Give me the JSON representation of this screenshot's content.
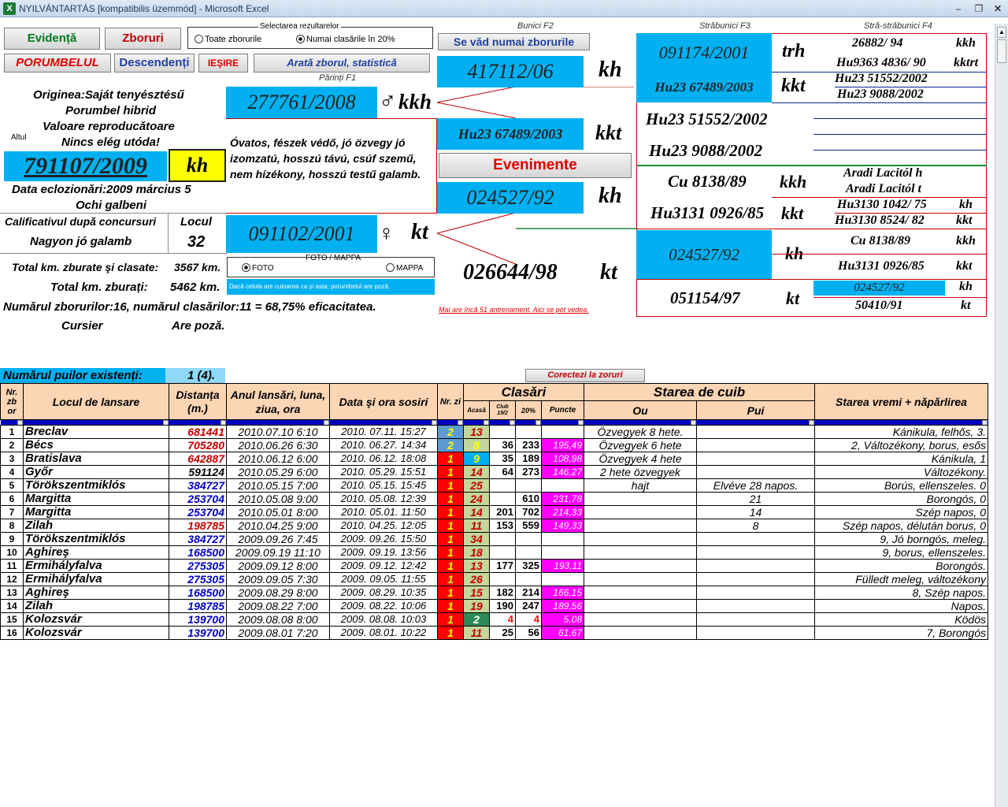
{
  "window": {
    "title": "NYILVÁNTARTÁS  [kompatibilis üzemmód] - Microsoft Excel",
    "minimize": "–",
    "restore": "❐",
    "close": "✕"
  },
  "buttons": {
    "evidenta": "Evidențǎ",
    "zboruri": "Zboruri",
    "porumbelul": "PORUMBELUL",
    "descendenti": "Descendenți",
    "iesire": "IEŞIRE",
    "arata": "Aratǎ zborul, statisticǎ",
    "se_vad": "Se vǎd numai zborurile",
    "evenimente": "Evenimente",
    "corectezi": "Corectezi la zoruri"
  },
  "selection": {
    "title": "Selectarea rezultarelor",
    "opt_all": "Toate zborurile",
    "opt_20": "Numai clasǎrile în 20%",
    "selected": "opt_20"
  },
  "headings": {
    "bunici": "Bunici F2",
    "strabunici": "Strǎbunici F3",
    "stra_strabunici": "Strǎ-strǎbunici F4",
    "parinti": "Pǎrinți F1"
  },
  "bird": {
    "origin": "Originea:Saját tenyésztésű",
    "type": "Porumbel hibrid",
    "value": "Valoare reproducǎtoare",
    "offspring": "Nincs elég utóda!",
    "altul": "Altul",
    "ring": "791107/2009",
    "code": "kh",
    "hatch": "Data eclozionǎri:2009  március   5",
    "eyes": "Ochi galbeni",
    "calif_label": "Calificativul dupǎ concursuri",
    "calif_value": "Nagyon jó galamb",
    "locul_label": "Locul",
    "locul_value": "32",
    "km_clasate_label": "Total km. zburate şi clasate:",
    "km_clasate_value": "3567 km.",
    "km_zburati_label": "Total km. zburați:",
    "km_zburati_value": "5462 km.",
    "summary": "Numǎrul zborurilor:16,  numǎrul clasǎrilor:11 = 68,75% eficacitatea.",
    "cursier": "Cursier",
    "poza": "Are pozǎ.",
    "puilor_label": "Numǎrul puilor existenți:",
    "puilor_value": "1 (4)."
  },
  "parents": {
    "father_ring": "277761/2008",
    "father_sym": "♂",
    "father_code": "kkh",
    "note": "Óvatos, fészek védő, jó özvegy jó izomzatú, hosszú távú, csúf szemű, nem hízékony, hosszú testű galamb.",
    "mother_ring": "091102/2001",
    "mother_sym": "♀",
    "mother_code": "kt",
    "foto_label": "FOTO   /     MAPPA",
    "foto_opt": "FOTO",
    "mappa_opt": "MAPPA",
    "color_note": "Dacǎ celula are culoarea ca şi asta: porumbelul are pozǎ."
  },
  "grandparents": {
    "g1_ring": "417112/06",
    "g1_code": "kh",
    "g2_ring": "Hu23 67489/2003",
    "g2_code": "kkt",
    "g3_ring": "024527/92",
    "g3_code": "kh",
    "g4_ring": "026644/98",
    "g4_code": "kt",
    "training_note": "Mai are încǎ 51 antrenament. Aici se pot vedea."
  },
  "great": {
    "r1_ring": "091174/2001",
    "r1_code": "trh",
    "r2_ring": "Hu23 67489/2003",
    "r2_code": "kkt",
    "r3_ring": "Hu23 51552/2002",
    "r4_ring": "Hu23 9088/2002",
    "r5_ring": "Cu 8138/89",
    "r5_code": "kkh",
    "r6_ring": "Hu3131 0926/85",
    "r6_code": "kkt",
    "r7_ring": "024527/92",
    "r7_code": "kh",
    "r8_ring": "051154/97",
    "r8_code": "kt"
  },
  "great2": {
    "a1": "26882/ 94",
    "a1c": "kkh",
    "a2": "Hu9363 4836/ 90",
    "a2c": "kktrt",
    "a3": "Hu23 51552/2002",
    "a4": "Hu23 9088/2002",
    "a5": "Aradi Lacitól h",
    "a6": "Aradi Lacitól t",
    "a7": "Hu3130 1042/ 75",
    "a7c": "kh",
    "a8": "Hu3130 8524/ 82",
    "a8c": "kkt",
    "a9": "Cu 8138/89",
    "a9c": "kkh",
    "a10": "Hu3131 0926/85",
    "a10c": "kkt",
    "a11": "024527/92",
    "a11c": "kh",
    "a12": "50410/91",
    "a12c": "kt"
  },
  "table": {
    "headers": {
      "nr": "Nr. zb or",
      "loc": "Locul de lansare",
      "dist": "Distanța (m.)",
      "an": "Anul lansǎri, luna, ziua, ora",
      "data": "Data şi ora sosiri",
      "nrzi": "Nr. zi",
      "clasari": "Clasǎri",
      "acasa": "Acasǎ",
      "club": "Club 19/2",
      "p20": "20%",
      "puncte": "Puncte",
      "cuib": "Starea de cuib",
      "ou": "Ou",
      "pui": "Pui",
      "vreme": "Starea vremi + nǎpǎrlirea"
    },
    "rows": [
      {
        "nr": "1",
        "loc": "Breclav",
        "dist": "681441",
        "dc": "#c00000",
        "an": "2010.07.10 6:10",
        "data": "2010. 07.11. 15:27",
        "nz": "2",
        "nzbg": "#5b9bd5",
        "nzc": "#ffff00",
        "ac": "13",
        "acc": "#c00000",
        "club": "",
        "p20": "",
        "pct": "",
        "ou": "Özvegyek 8 hete.",
        "pui": "",
        "st": "Kánikula, felhős, 3."
      },
      {
        "nr": "2",
        "loc": "Bécs",
        "dist": "705280",
        "dc": "#c00000",
        "an": "2010.06.26 6:30",
        "data": "2010. 06.27. 14:34",
        "nz": "2",
        "nzbg": "#5b9bd5",
        "nzc": "#ffff00",
        "ac": "8",
        "acc": "#ffff00",
        "club": "36",
        "p20": "233",
        "pct": "195,49",
        "ou": "Özvegyek 6 hete",
        "pui": "",
        "st": "2, Változékony, borus, esős"
      },
      {
        "nr": "3",
        "loc": "Bratislava",
        "dist": "642887",
        "dc": "#c00000",
        "an": "2010.06.12 6:00",
        "data": "2010. 06.12. 18:08",
        "nz": "1",
        "nzbg": "#ff0000",
        "nzc": "#ffff00",
        "ac": "9",
        "acc": "#ffff00",
        "acbg": "#00b0f0",
        "club": "35",
        "p20": "189",
        "pct": "108,98",
        "ou": "Özvegyek 4 hete",
        "pui": "",
        "st": "Kánikula, 1"
      },
      {
        "nr": "4",
        "loc": "Győr",
        "dist": "591124",
        "dc": "#000000",
        "an": "2010.05.29 6:00",
        "data": "2010. 05.29. 15:51",
        "nz": "1",
        "nzbg": "#ff0000",
        "nzc": "#ffff00",
        "ac": "14",
        "acc": "#c00000",
        "club": "64",
        "p20": "273",
        "pct": "146,27",
        "ou": "2 hete özvegyek",
        "pui": "",
        "st": "Változékony."
      },
      {
        "nr": "5",
        "loc": "Törökszentmiklós",
        "dist": "384727",
        "dc": "#0000c0",
        "an": "2010.05.15 7:00",
        "data": "2010. 05.15. 15:45",
        "nz": "1",
        "nzbg": "#ff0000",
        "nzc": "#ffff00",
        "ac": "25",
        "acc": "#c00000",
        "club": "",
        "p20": "",
        "pct": "",
        "ou": "hajt",
        "pui": "Elvéve 28 napos.",
        "st": "Borús, ellenszeles. 0"
      },
      {
        "nr": "6",
        "loc": "Margitta",
        "dist": "253704",
        "dc": "#0000c0",
        "an": "2010.05.08 9:00",
        "data": "2010. 05.08. 12:39",
        "nz": "1",
        "nzbg": "#ff0000",
        "nzc": "#ffff00",
        "ac": "24",
        "acc": "#c00000",
        "club": "",
        "p20": "610",
        "pct": "231,78",
        "ou": "",
        "pui": "21",
        "st": "Borongós, 0"
      },
      {
        "nr": "7",
        "loc": "Margitta",
        "dist": "253704",
        "dc": "#0000c0",
        "an": "2010.05.01 8:00",
        "data": "2010. 05.01. 11:50",
        "nz": "1",
        "nzbg": "#ff0000",
        "nzc": "#ffff00",
        "ac": "14",
        "acc": "#c00000",
        "club": "201",
        "p20": "702",
        "pct": "214,33",
        "ou": "",
        "pui": "14",
        "st": "Szép napos, 0"
      },
      {
        "nr": "8",
        "loc": "Zilah",
        "dist": "198785",
        "dc": "#c00000",
        "an": "2010.04.25 9:00",
        "data": "2010. 04.25. 12:05",
        "nz": "1",
        "nzbg": "#ff0000",
        "nzc": "#ffff00",
        "ac": "11",
        "acc": "#c00000",
        "club": "153",
        "p20": "559",
        "pct": "149,33",
        "ou": "",
        "pui": "8",
        "st": "Szép napos, délután borus, 0"
      },
      {
        "nr": "9",
        "loc": "Törökszentmiklós",
        "dist": "384727",
        "dc": "#0000c0",
        "an": "2009.09.26 7:45",
        "data": "2009. 09.26. 15:50",
        "nz": "1",
        "nzbg": "#ff0000",
        "nzc": "#ffff00",
        "ac": "34",
        "acc": "#c00000",
        "club": "",
        "p20": "",
        "pct": "",
        "ou": "",
        "pui": "",
        "st": "9, Jó borngós, meleg."
      },
      {
        "nr": "10",
        "loc": "Aghireş",
        "dist": "168500",
        "dc": "#0000c0",
        "an": "2009.09.19 11:10",
        "data": "2009. 09.19. 13:56",
        "nz": "1",
        "nzbg": "#ff0000",
        "nzc": "#ffff00",
        "ac": "18",
        "acc": "#c00000",
        "club": "",
        "p20": "",
        "pct": "",
        "ou": "",
        "pui": "",
        "st": "9, borus, ellenszeles."
      },
      {
        "nr": "11",
        "loc": "Ermihályfalva",
        "dist": "275305",
        "dc": "#0000c0",
        "an": "2009.09.12 8:00",
        "data": "2009. 09.12. 12:42",
        "nz": "1",
        "nzbg": "#ff0000",
        "nzc": "#ffff00",
        "ac": "13",
        "acc": "#c00000",
        "club": "177",
        "p20": "325",
        "pct": "193,11",
        "ou": "",
        "pui": "",
        "st": "Borongós."
      },
      {
        "nr": "12",
        "loc": "Ermihályfalva",
        "dist": "275305",
        "dc": "#0000c0",
        "an": "2009.09.05 7:30",
        "data": "2009. 09.05. 11:55",
        "nz": "1",
        "nzbg": "#ff0000",
        "nzc": "#ffff00",
        "ac": "26",
        "acc": "#c00000",
        "club": "",
        "p20": "",
        "pct": "",
        "ou": "",
        "pui": "",
        "st": "Fülledt meleg, változékony"
      },
      {
        "nr": "13",
        "loc": "Aghireş",
        "dist": "168500",
        "dc": "#0000c0",
        "an": "2009.08.29 8:00",
        "data": "2009. 08.29. 10:35",
        "nz": "1",
        "nzbg": "#ff0000",
        "nzc": "#ffff00",
        "ac": "15",
        "acc": "#c00000",
        "club": "182",
        "p20": "214",
        "pct": "166,15",
        "ou": "",
        "pui": "",
        "st": "8, Szép napos."
      },
      {
        "nr": "14",
        "loc": "Zilah",
        "dist": "198785",
        "dc": "#0000c0",
        "an": "2009.08.22 7:00",
        "data": "2009. 08.22. 10:06",
        "nz": "1",
        "nzbg": "#ff0000",
        "nzc": "#ffff00",
        "ac": "19",
        "acc": "#c00000",
        "club": "190",
        "p20": "247",
        "pct": "189,56",
        "ou": "",
        "pui": "",
        "st": "Napos."
      },
      {
        "nr": "15",
        "loc": "Kolozsvár",
        "dist": "139700",
        "dc": "#0000c0",
        "an": "2009.08.08 8:00",
        "data": "2009. 08.08. 10:03",
        "nz": "1",
        "nzbg": "#ff0000",
        "nzc": "#ffff00",
        "ac": "2",
        "acc": "#ffffff",
        "acbg": "#2e8b57",
        "club": "4",
        "clubc": "#ff0000",
        "p20": "4",
        "p20c": "#ff0000",
        "pct": "5,08",
        "ou": "",
        "pui": "",
        "st": "Ködös"
      },
      {
        "nr": "16",
        "loc": "Kolozsvár",
        "dist": "139700",
        "dc": "#0000c0",
        "an": "2009.08.01 7:20",
        "data": "2009. 08.01. 10:22",
        "nz": "1",
        "nzbg": "#ff0000",
        "nzc": "#ffff00",
        "ac": "11",
        "acc": "#c00000",
        "club": "25",
        "p20": "56",
        "pct": "61,67",
        "ou": "",
        "pui": "",
        "st": "7,  Borongós"
      }
    ]
  }
}
